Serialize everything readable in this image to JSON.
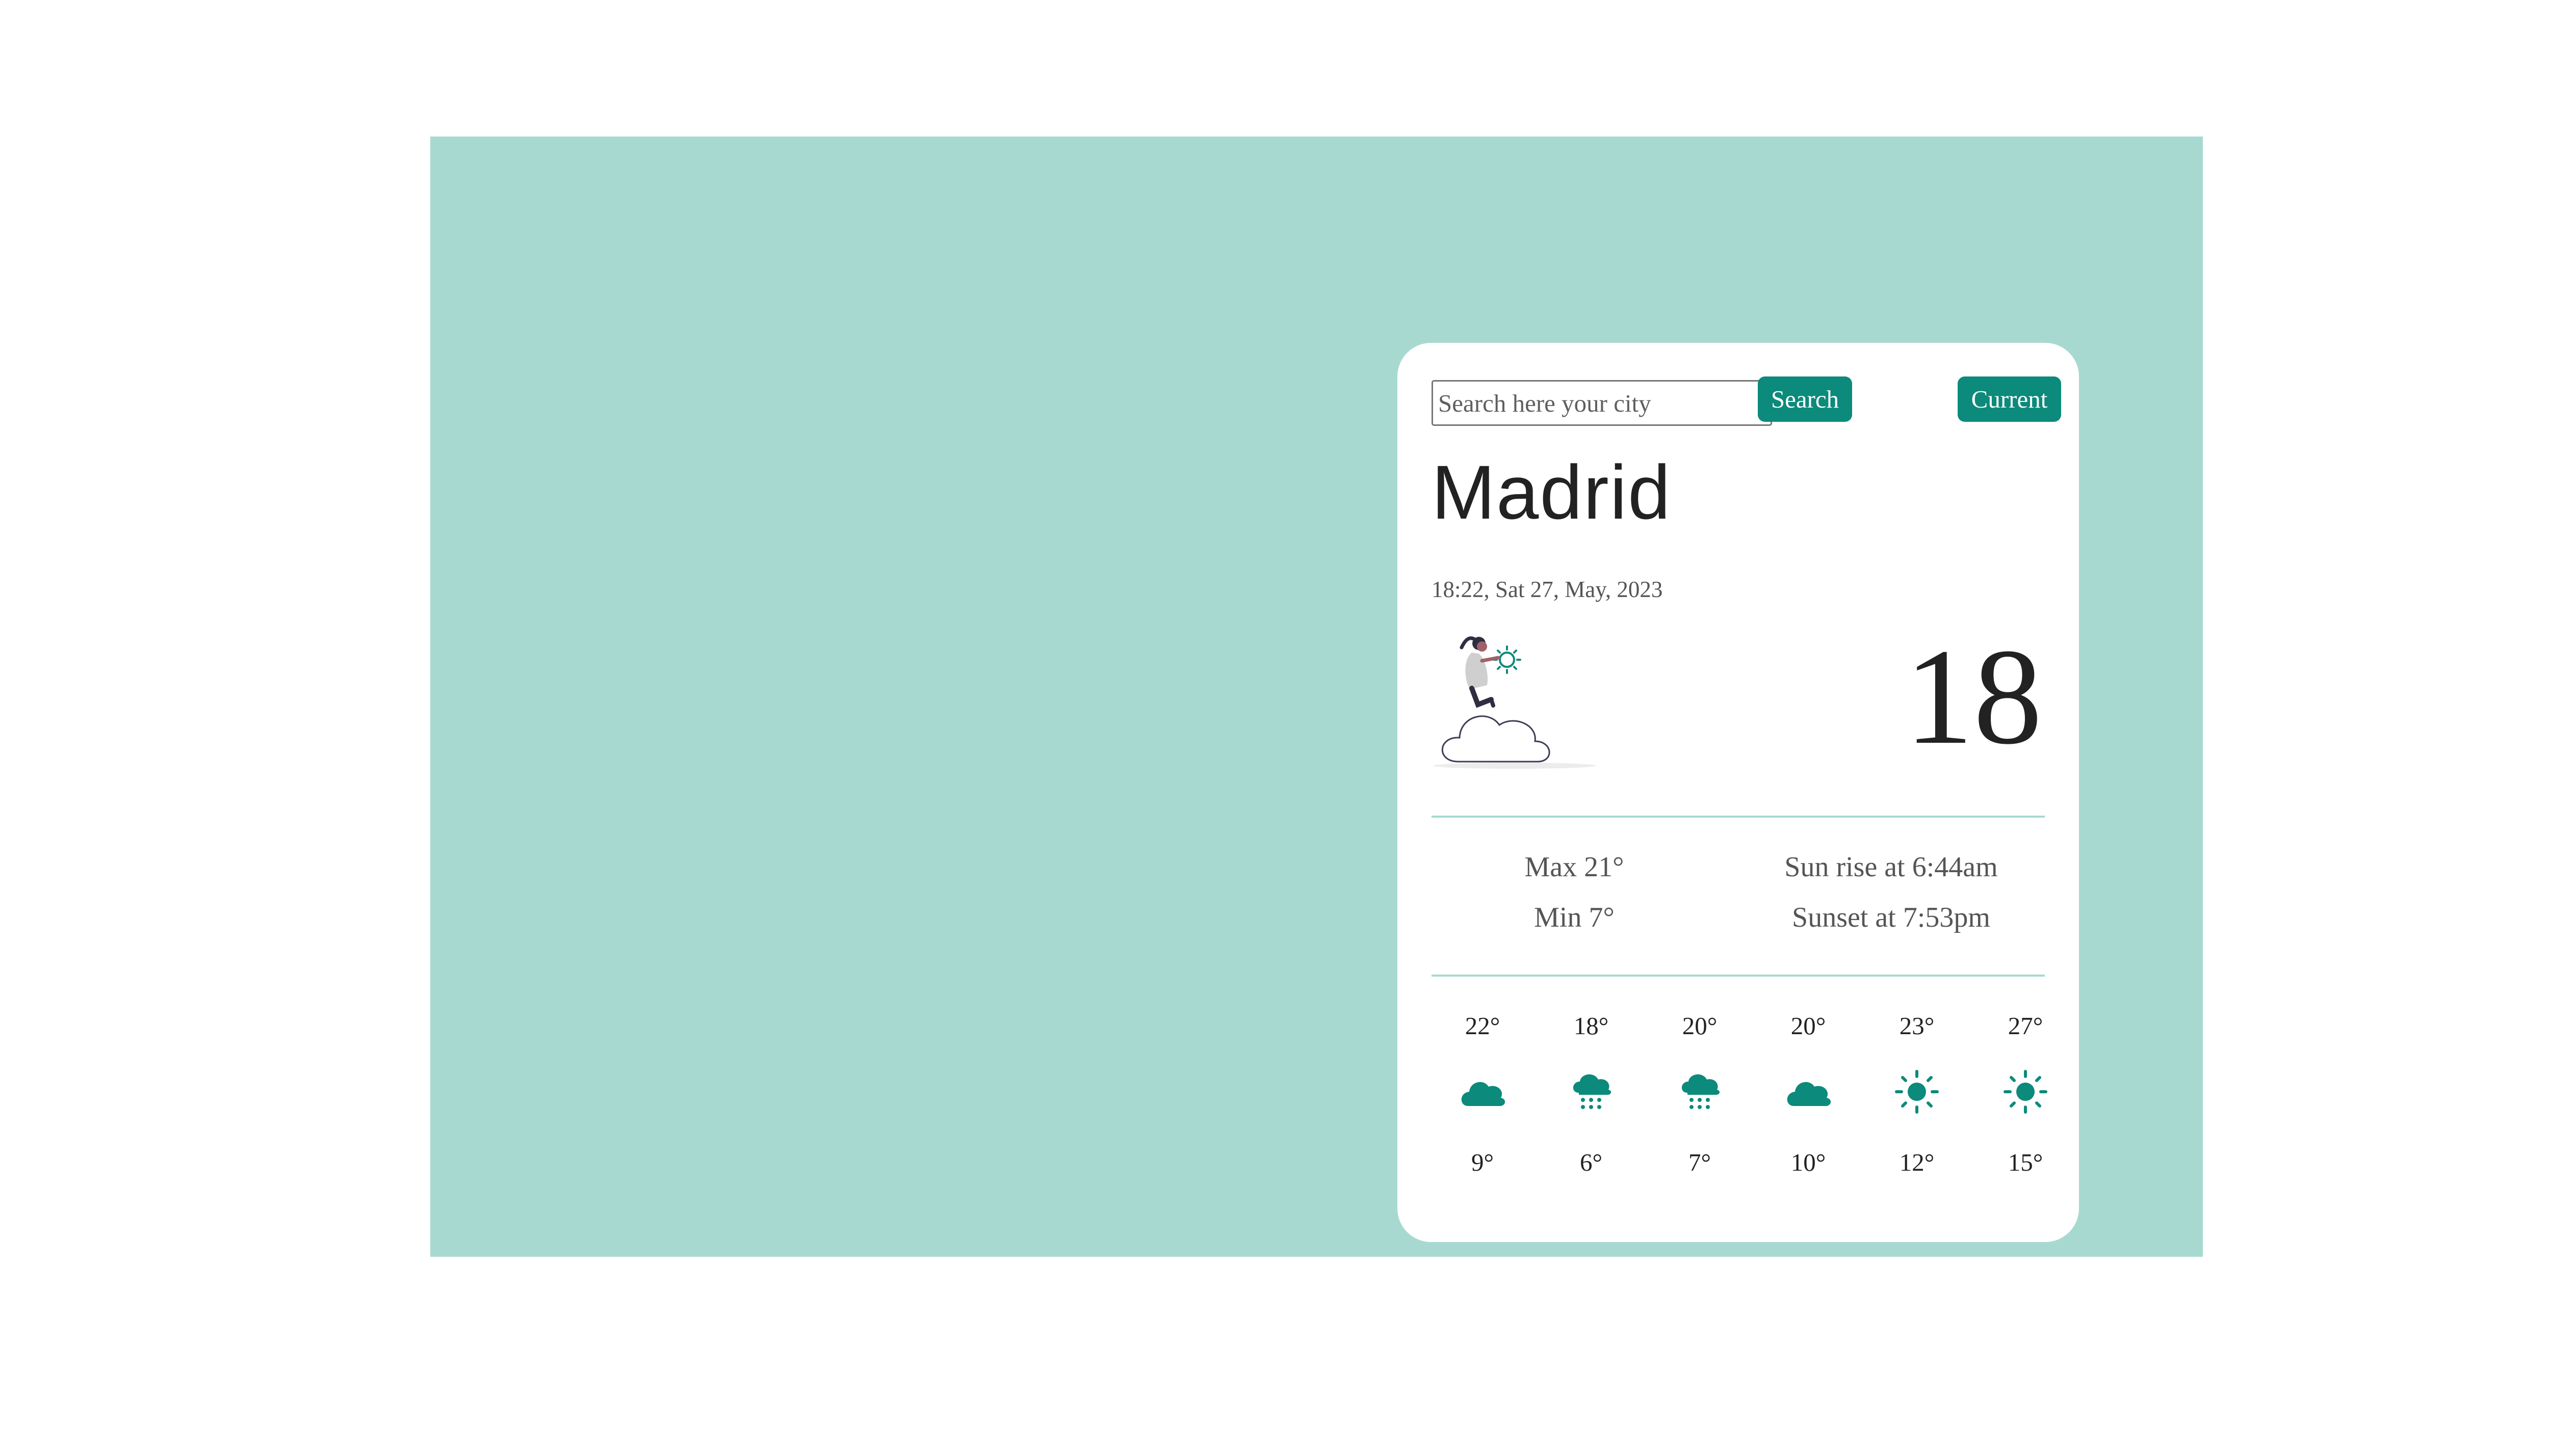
{
  "colors": {
    "accent": "#0c8a7b",
    "background": "#a8d9d1",
    "card": "#ffffff"
  },
  "search": {
    "placeholder": "Search here your city",
    "value": "",
    "search_label": "Search",
    "current_label": "Current"
  },
  "weather": {
    "city": "Madrid",
    "datetime": "18:22, Sat 27, May, 2023",
    "temperature": "18",
    "illustration": "woman-on-cloud-illustration",
    "max": "Max 21°",
    "min": "Min 7°",
    "sunrise": "Sun rise at 6:44am",
    "sunset": "Sunset at 7:53pm"
  },
  "forecast": [
    {
      "high": "22°",
      "low": "9°",
      "icon": "cloud-icon"
    },
    {
      "high": "18°",
      "low": "6°",
      "icon": "rain-cloud-icon"
    },
    {
      "high": "20°",
      "low": "7°",
      "icon": "rain-cloud-icon"
    },
    {
      "high": "20°",
      "low": "10°",
      "icon": "cloud-icon"
    },
    {
      "high": "23°",
      "low": "12°",
      "icon": "sun-icon"
    },
    {
      "high": "27°",
      "low": "15°",
      "icon": "sun-icon"
    }
  ]
}
